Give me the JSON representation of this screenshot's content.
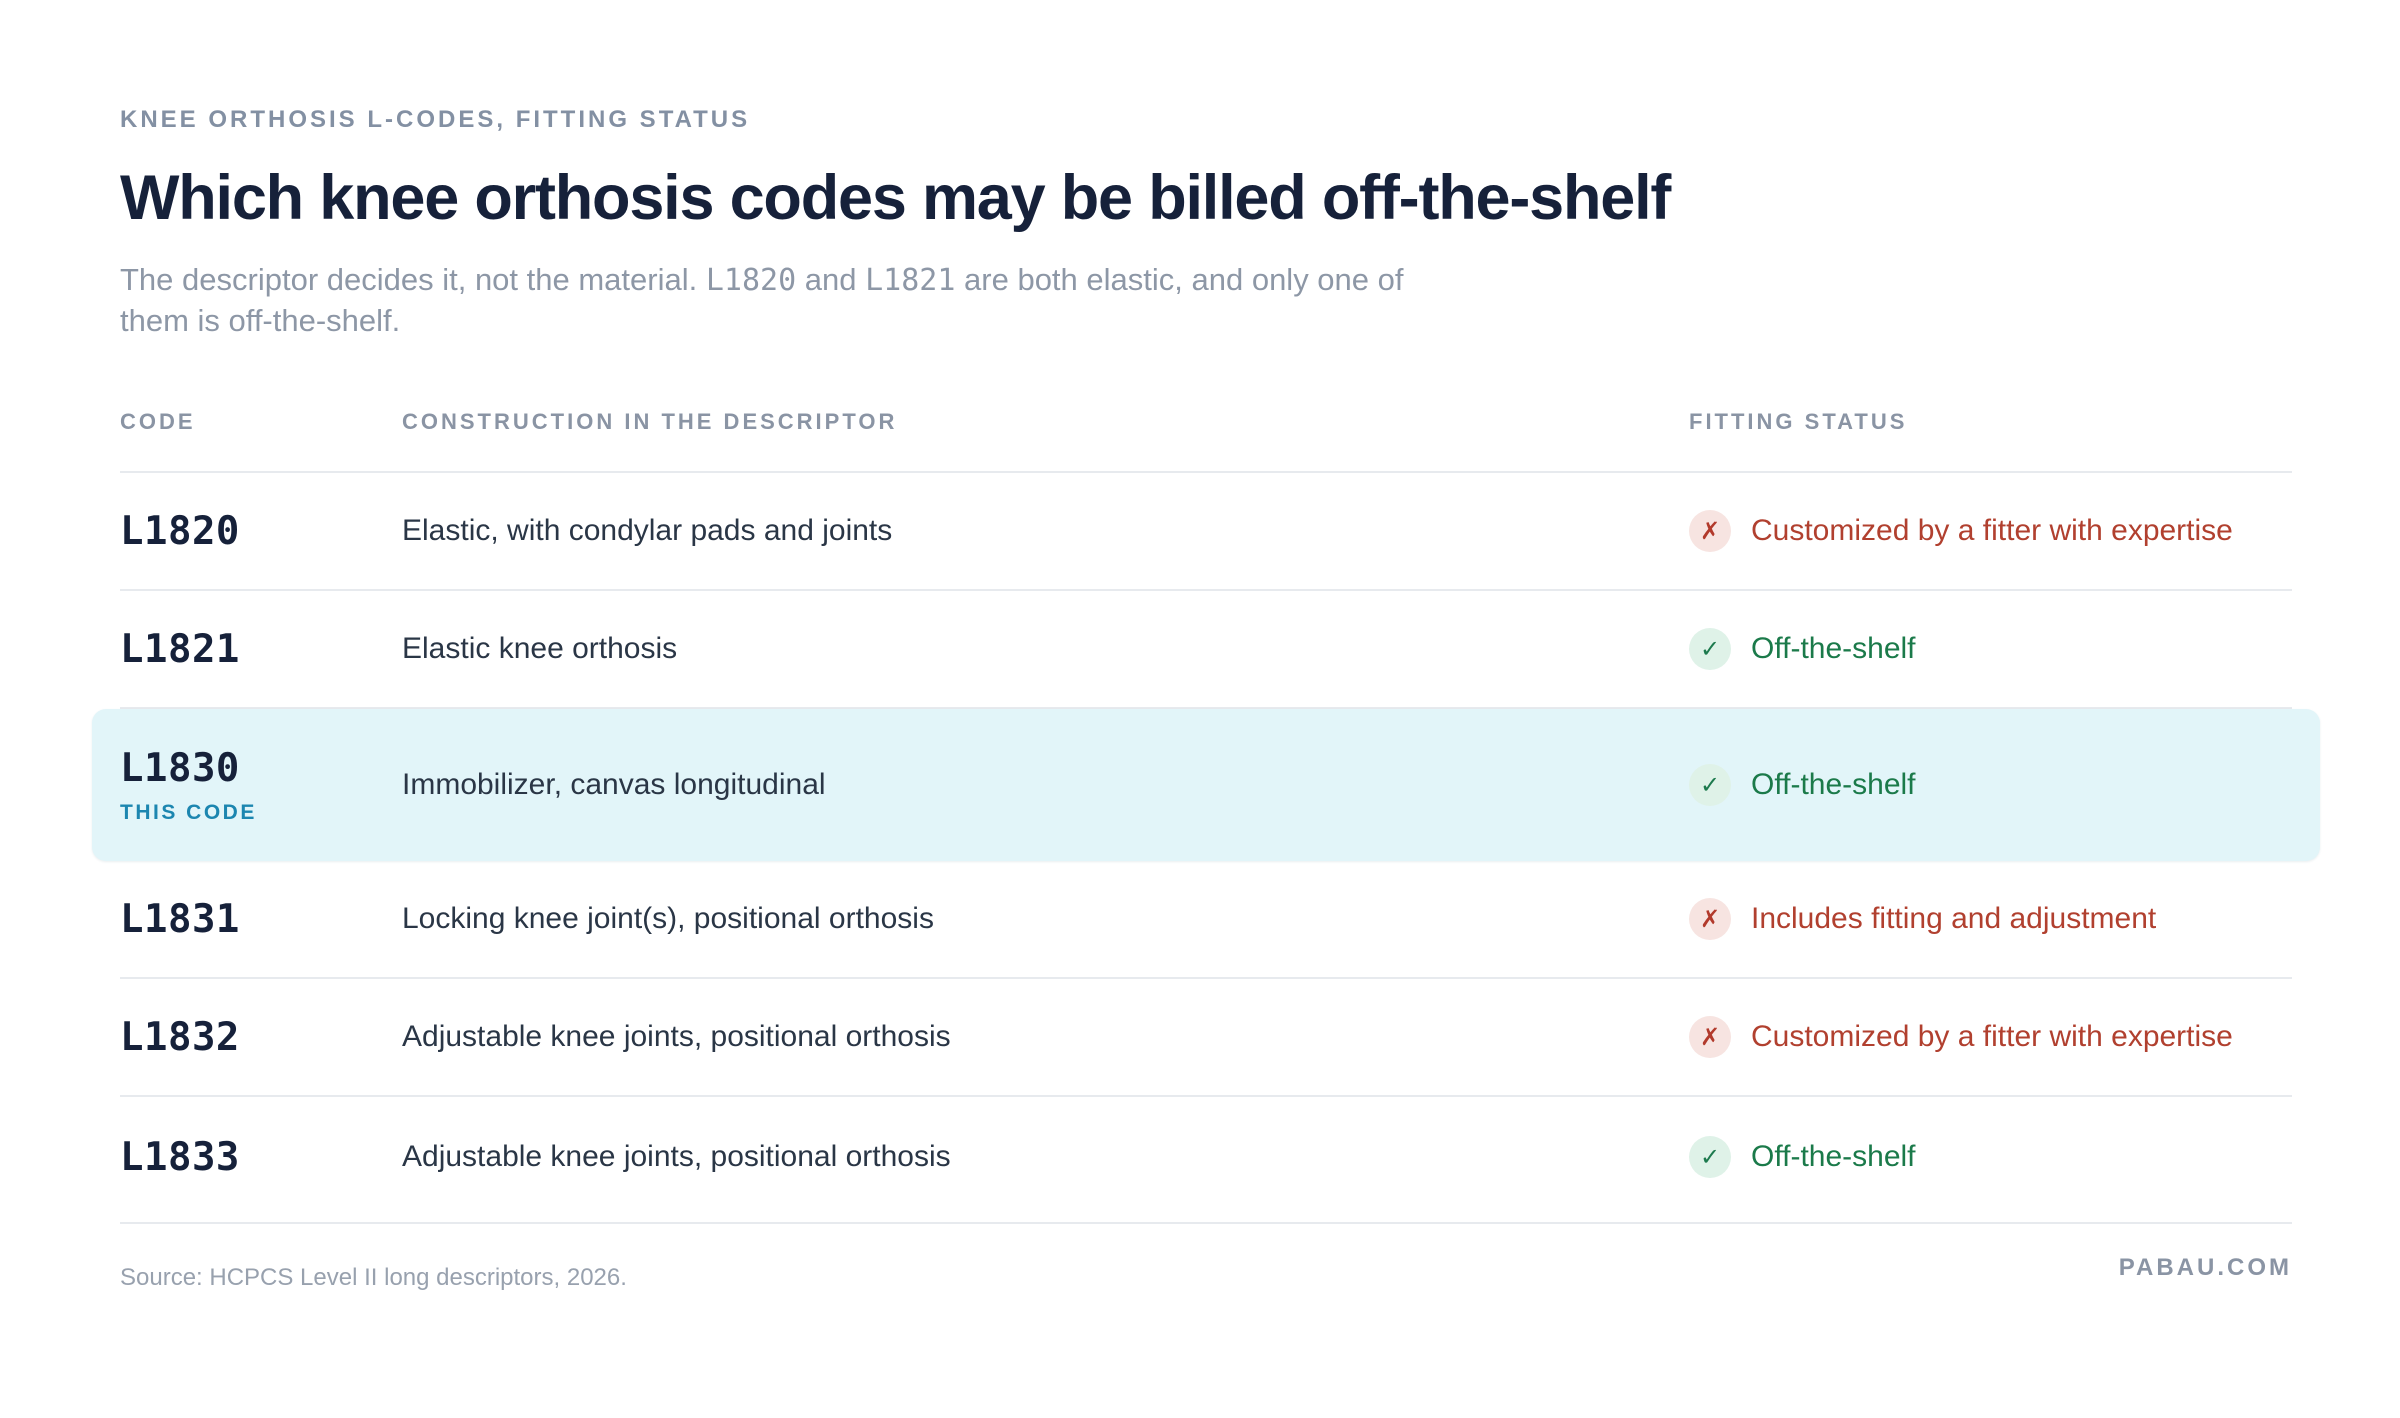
{
  "header": {
    "eyebrow": "KNEE ORTHOSIS L-CODES, FITTING STATUS",
    "title": "Which knee orthosis codes may be billed off-the-shelf",
    "subtitle_part1": "The descriptor decides it, not the material. ",
    "subtitle_code1": "L1820",
    "subtitle_part2": " and ",
    "subtitle_code2": "L1821",
    "subtitle_part3": " are both elastic, and only one of them is off-the-shelf."
  },
  "table": {
    "columns": {
      "code": "CODE",
      "construction": "CONSTRUCTION IN THE DESCRIPTOR",
      "status": "FITTING STATUS"
    },
    "rows": [
      {
        "code": "L1820",
        "construction": "Elastic, with condylar pads and joints",
        "status": "Customized by a fitter with expertise",
        "status_kind": "bad",
        "icon": "✗"
      },
      {
        "code": "L1821",
        "construction": "Elastic knee orthosis",
        "status": "Off-the-shelf",
        "status_kind": "good",
        "icon": "✓"
      },
      {
        "code": "L1830",
        "construction": "Immobilizer, canvas longitudinal",
        "status": "Off-the-shelf",
        "status_kind": "good",
        "icon": "✓",
        "tag": "THIS CODE"
      },
      {
        "code": "L1831",
        "construction": "Locking knee joint(s), positional orthosis",
        "status": "Includes fitting and adjustment",
        "status_kind": "bad",
        "icon": "✗"
      },
      {
        "code": "L1832",
        "construction": "Adjustable knee joints, positional orthosis",
        "status": "Customized by a fitter with expertise",
        "status_kind": "bad",
        "icon": "✗"
      },
      {
        "code": "L1833",
        "construction": "Adjustable knee joints, positional orthosis",
        "status": "Off-the-shelf",
        "status_kind": "good",
        "icon": "✓"
      }
    ]
  },
  "footer": {
    "source": "Source: HCPCS Level II long descriptors, 2026.",
    "brand": "PABAU.COM"
  },
  "colors": {
    "highlight_bg": "#e2f5f9",
    "good": "#1b7a4a",
    "bad": "#b1402f",
    "accent": "#1c86b0"
  }
}
